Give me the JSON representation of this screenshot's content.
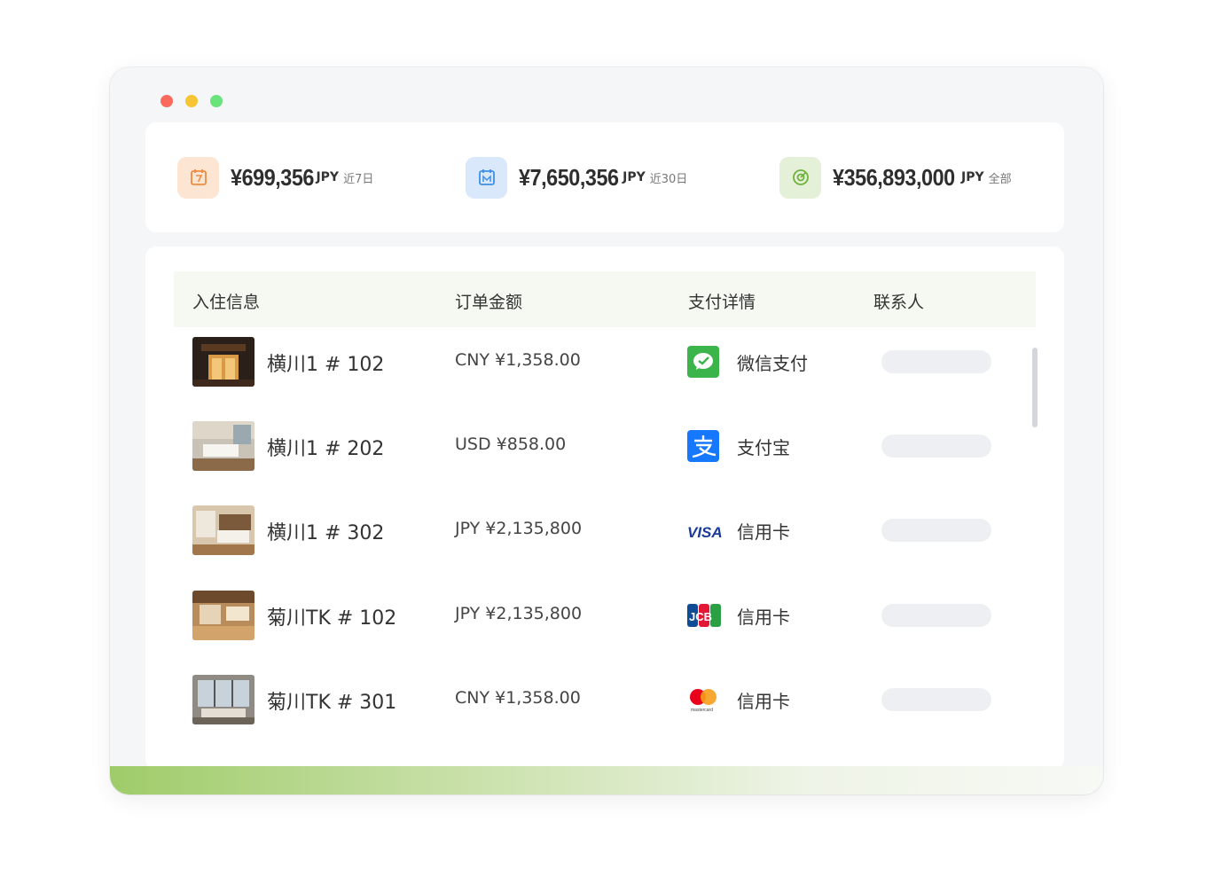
{
  "window": {
    "controls": [
      "close",
      "minimize",
      "maximize"
    ]
  },
  "stats": [
    {
      "icon": "calendar-7-icon",
      "amount": "¥699,356",
      "currency": "JPY",
      "period": "近7日",
      "accent": "#f08a3e"
    },
    {
      "icon": "calendar-30-icon",
      "amount": "¥7,650,356",
      "currency": "JPY",
      "period": "近30日",
      "accent": "#3f8fe6"
    },
    {
      "icon": "target-icon",
      "amount": "¥356,893,000",
      "currency": "JPY",
      "period": "全部",
      "accent": "#6db23c"
    }
  ],
  "table": {
    "headers": [
      "入住信息",
      "订单金额",
      "支付详情",
      "联系人"
    ],
    "rows": [
      {
        "room": "横川1 # 102",
        "amount": "CNY ¥1,358.00",
        "payment_icon": "wechat-pay-icon",
        "payment": "微信支付"
      },
      {
        "room": "横川1 # 202",
        "amount": "USD ¥858.00",
        "payment_icon": "alipay-icon",
        "payment": "支付宝"
      },
      {
        "room": "横川1 # 302",
        "amount": "JPY ¥2,135,800",
        "payment_icon": "visa-icon",
        "payment": "信用卡"
      },
      {
        "room": "菊川TK # 102",
        "amount": "JPY ¥2,135,800",
        "payment_icon": "jcb-icon",
        "payment": "信用卡"
      },
      {
        "room": "菊川TK # 301",
        "amount": "CNY ¥1,358.00",
        "payment_icon": "mastercard-icon",
        "payment": "信用卡"
      }
    ]
  },
  "logos": {
    "visa": "VISA",
    "jcb": "JCB",
    "mastercard": "mastercard"
  },
  "colors": {
    "accent_green": "#9fcc6a",
    "header_bg": "#f6f9f1"
  }
}
